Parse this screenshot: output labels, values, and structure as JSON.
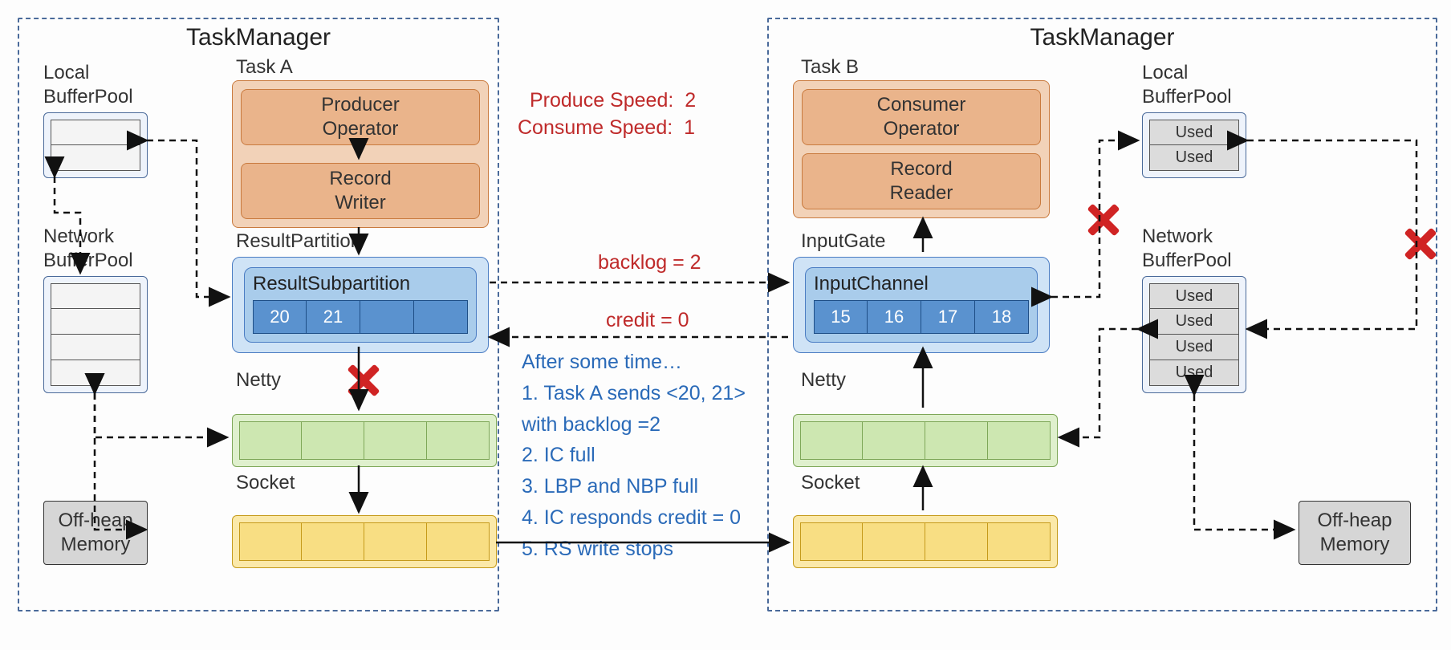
{
  "left": {
    "title": "TaskManager",
    "local_pool_label": "Local\nBufferPool",
    "local_slots": [
      "",
      ""
    ],
    "network_pool_label": "Network\nBufferPool",
    "network_slots": [
      "",
      "",
      "",
      ""
    ],
    "offheap_label": "Off-heap\nMemory",
    "task_label": "Task A",
    "op_top": "Producer\nOperator",
    "op_bottom": "Record\nWriter",
    "partition_label": "ResultPartition",
    "sub_label": "ResultSubpartition",
    "sub_cells": [
      "20",
      "21",
      "",
      ""
    ],
    "netty_label": "Netty",
    "socket_label": "Socket"
  },
  "right": {
    "title": "TaskManager",
    "local_pool_label": "Local\nBufferPool",
    "local_slots": [
      "Used",
      "Used"
    ],
    "network_pool_label": "Network\nBufferPool",
    "network_slots": [
      "Used",
      "Used",
      "Used",
      "Used"
    ],
    "offheap_label": "Off-heap\nMemory",
    "task_label": "Task B",
    "op_top": "Consumer\nOperator",
    "op_bottom": "Record\nReader",
    "gate_label": "InputGate",
    "channel_label": "InputChannel",
    "channel_cells": [
      "15",
      "16",
      "17",
      "18"
    ],
    "netty_label": "Netty",
    "socket_label": "Socket"
  },
  "center": {
    "produce_label": "Produce Speed:",
    "produce_val": "2",
    "consume_label": "Consume Speed:",
    "consume_val": "1",
    "backlog": "backlog = 2",
    "credit": "credit = 0",
    "story_intro": "After some time…",
    "story": [
      "1.   Task A sends <20, 21>",
      "with backlog =2",
      "2.   IC full",
      "3.   LBP and NBP full",
      "4.   IC responds credit = 0",
      "5.   RS write stops"
    ]
  }
}
